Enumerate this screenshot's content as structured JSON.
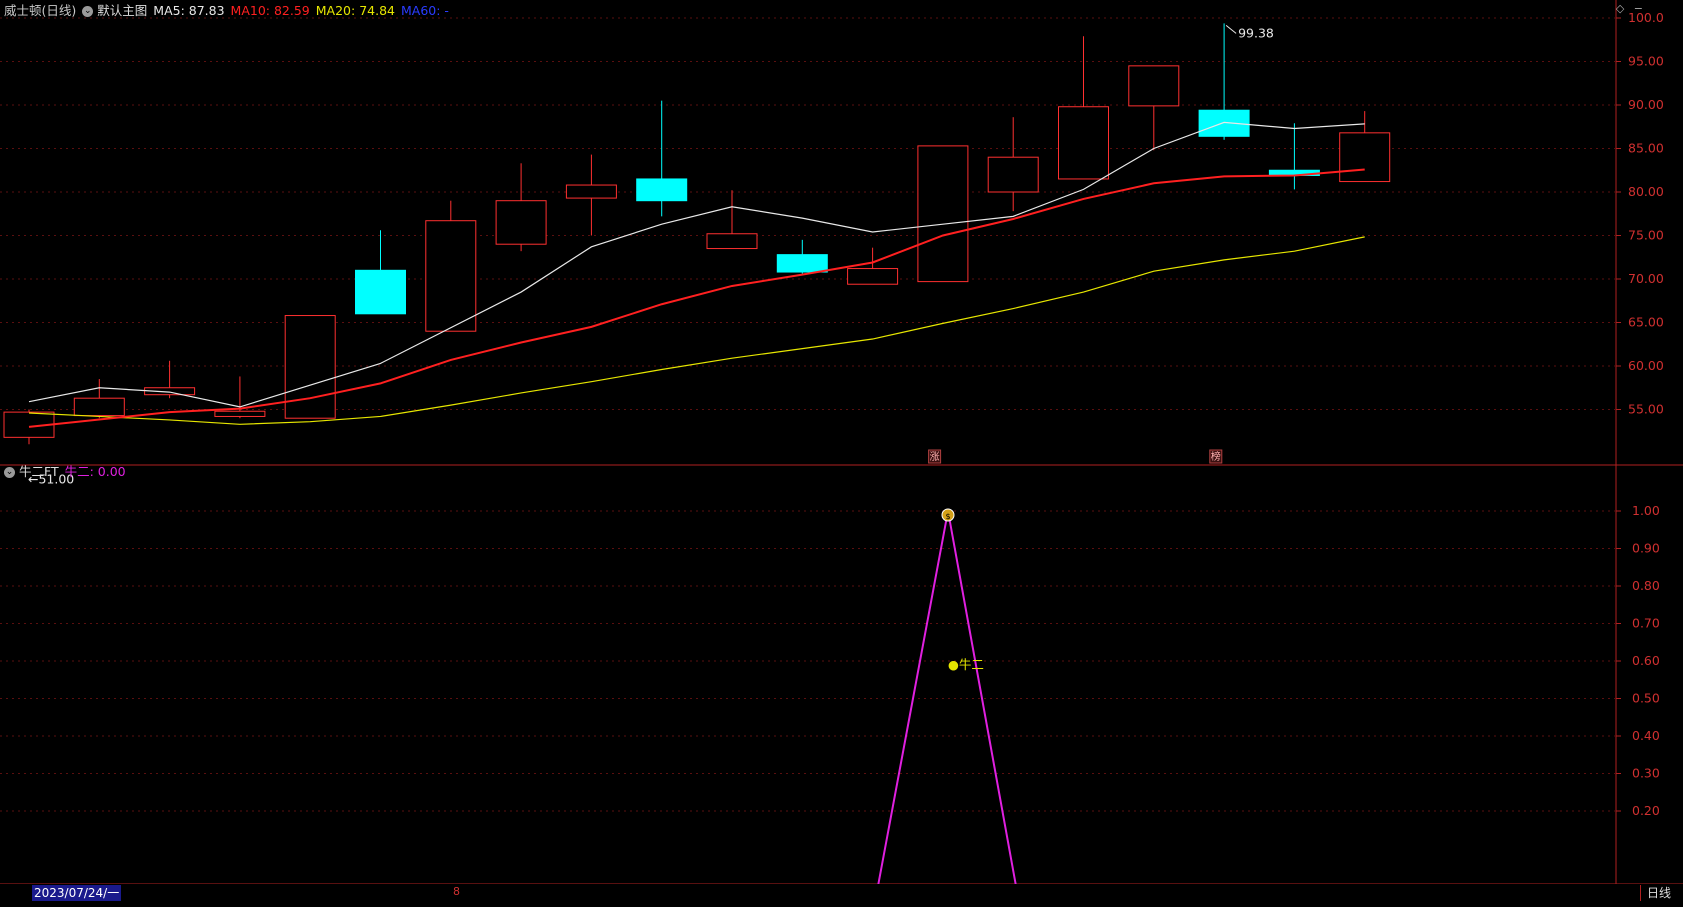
{
  "top_pane": {
    "stock_title": "威士顿(日线)",
    "template_label": "默认主图",
    "ma5": "MA5: 87.83",
    "ma10": "MA10: 82.59",
    "ma20": "MA20: 74.84",
    "ma60": "MA60: -",
    "colors": {
      "ma5": "#e8e8e8",
      "ma10": "#ff2020",
      "ma20": "#e6e600",
      "ma60": "#2a3cff",
      "up": "#ff3030",
      "down": "#00ffff"
    },
    "high_marker": "99.38",
    "low_marker": "51.00",
    "signal_left": "涨",
    "signal_right": "榜"
  },
  "bottom_pane": {
    "indicator_title": "牛二FT",
    "indicator_value": "牛二: 0.00",
    "line_label": "●牛二",
    "line_color": "#e020e0",
    "money_icon": "money-bag-icon"
  },
  "status_bar": {
    "date": "2023/07/24/一",
    "marker": "8",
    "period": "日线"
  },
  "chart_data": [
    {
      "type": "candlestick",
      "title": "",
      "ylim": [
        50,
        100
      ],
      "y_ticks": [
        "100.0",
        "95.00",
        "90.00",
        "85.00",
        "80.00",
        "75.00",
        "70.00",
        "65.00",
        "60.00",
        "55.00"
      ],
      "candles": [
        {
          "open": 51.8,
          "close": 54.7,
          "high": 55.0,
          "low": 51.0
        },
        {
          "open": 54.3,
          "close": 56.3,
          "high": 58.5,
          "low": 54.0
        },
        {
          "open": 56.7,
          "close": 57.5,
          "high": 60.6,
          "low": 56.3
        },
        {
          "open": 54.2,
          "close": 54.8,
          "high": 58.8,
          "low": 54.0
        },
        {
          "open": 54.0,
          "close": 65.8,
          "high": 65.8,
          "low": 54.0
        },
        {
          "open": 71.0,
          "close": 66.0,
          "high": 75.6,
          "low": 66.0
        },
        {
          "open": 64.0,
          "close": 76.7,
          "high": 79.0,
          "low": 64.0
        },
        {
          "open": 74.0,
          "close": 79.0,
          "high": 83.3,
          "low": 73.2
        },
        {
          "open": 79.3,
          "close": 80.8,
          "high": 84.3,
          "low": 75.0
        },
        {
          "open": 81.5,
          "close": 79.0,
          "high": 90.5,
          "low": 77.2
        },
        {
          "open": 73.5,
          "close": 75.2,
          "high": 80.2,
          "low": 73.5
        },
        {
          "open": 72.8,
          "close": 70.8,
          "high": 74.5,
          "low": 70.6
        },
        {
          "open": 69.4,
          "close": 71.2,
          "high": 73.6,
          "low": 69.4
        },
        {
          "open": 69.7,
          "close": 85.3,
          "high": 85.3,
          "low": 69.7
        },
        {
          "open": 80.0,
          "close": 84.0,
          "high": 88.6,
          "low": 77.8
        },
        {
          "open": 81.5,
          "close": 89.8,
          "high": 97.9,
          "low": 81.5
        },
        {
          "open": 89.9,
          "close": 94.5,
          "high": 94.5,
          "low": 84.8
        },
        {
          "open": 89.4,
          "close": 86.4,
          "high": 99.38,
          "low": 86.0
        },
        {
          "open": 82.5,
          "close": 81.9,
          "high": 87.9,
          "low": 80.3
        },
        {
          "open": 81.2,
          "close": 86.8,
          "high": 89.3,
          "low": 81.2
        }
      ],
      "ma5": [
        55.9,
        57.5,
        57.0,
        55.3,
        null,
        null,
        null,
        null,
        null,
        null,
        null,
        null,
        null,
        null,
        null,
        null,
        null,
        null,
        null,
        null
      ],
      "ma5_points": [
        [
          0,
          55.9
        ],
        [
          1,
          57.5
        ],
        [
          2,
          57.0
        ],
        [
          3,
          55.3
        ],
        [
          5,
          60.3
        ],
        [
          7,
          68.5
        ],
        [
          8,
          73.7
        ],
        [
          9,
          76.3
        ],
        [
          10,
          78.3
        ],
        [
          11,
          77.0
        ],
        [
          12,
          75.4
        ],
        [
          13,
          76.3
        ],
        [
          14,
          77.2
        ],
        [
          15,
          80.3
        ],
        [
          16,
          85.0
        ],
        [
          17,
          88.0
        ],
        [
          18,
          87.3
        ],
        [
          19,
          87.83
        ]
      ],
      "ma10_points": [
        [
          0,
          53.0
        ],
        [
          2,
          54.7
        ],
        [
          3,
          55.1
        ],
        [
          4,
          56.3
        ],
        [
          5,
          58.0
        ],
        [
          6,
          60.7
        ],
        [
          7,
          62.7
        ],
        [
          8,
          64.5
        ],
        [
          9,
          67.1
        ],
        [
          10,
          69.2
        ],
        [
          11,
          70.5
        ],
        [
          12,
          71.9
        ],
        [
          13,
          75.0
        ],
        [
          14,
          76.9
        ],
        [
          15,
          79.2
        ],
        [
          16,
          81.0
        ],
        [
          17,
          81.8
        ],
        [
          18,
          81.9
        ],
        [
          19,
          82.59
        ]
      ],
      "ma20_points": [
        [
          0,
          54.6
        ],
        [
          1,
          54.2
        ],
        [
          2,
          53.8
        ],
        [
          3,
          53.3
        ],
        [
          4,
          53.6
        ],
        [
          5,
          54.2
        ],
        [
          6,
          55.5
        ],
        [
          7,
          56.9
        ],
        [
          8,
          58.2
        ],
        [
          9,
          59.6
        ],
        [
          10,
          60.9
        ],
        [
          11,
          62.0
        ],
        [
          12,
          63.1
        ],
        [
          13,
          64.9
        ],
        [
          14,
          66.6
        ],
        [
          15,
          68.5
        ],
        [
          16,
          70.9
        ],
        [
          17,
          72.2
        ],
        [
          18,
          73.2
        ],
        [
          19,
          74.84
        ]
      ]
    },
    {
      "type": "line",
      "title": "",
      "ylim": [
        0,
        1.05
      ],
      "y_ticks": [
        "1.00",
        "0.90",
        "0.80",
        "0.70",
        "0.60",
        "0.50",
        "0.40",
        "0.30",
        "0.20"
      ],
      "series": [
        {
          "name": "牛二",
          "points": [
            [
              0,
              0
            ],
            [
              12,
              0
            ],
            [
              13,
              1
            ],
            [
              14,
              0
            ],
            [
              19,
              0
            ]
          ]
        }
      ]
    }
  ]
}
